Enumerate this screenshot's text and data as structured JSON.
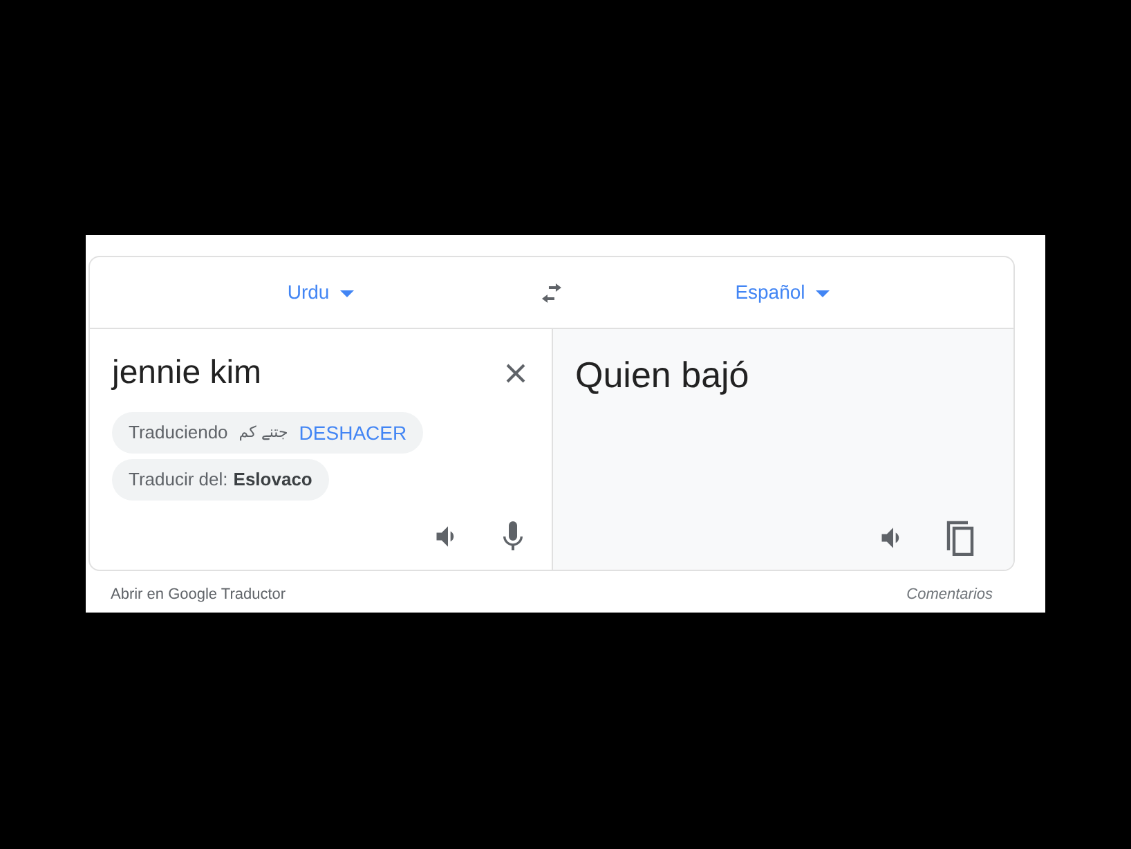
{
  "source_language": {
    "label": "Urdu"
  },
  "target_language": {
    "label": "Español"
  },
  "source": {
    "text": "jennie kim",
    "translating_label": "Traduciendo",
    "translating_text": "جتنے کم",
    "undo": "DESHACER",
    "detect_label": "Traducir del:",
    "detect_language": "Eslovaco"
  },
  "target": {
    "text": "Quien bajó"
  },
  "footer": {
    "open_link": "Abrir en Google Traductor",
    "feedback": "Comentarios"
  }
}
